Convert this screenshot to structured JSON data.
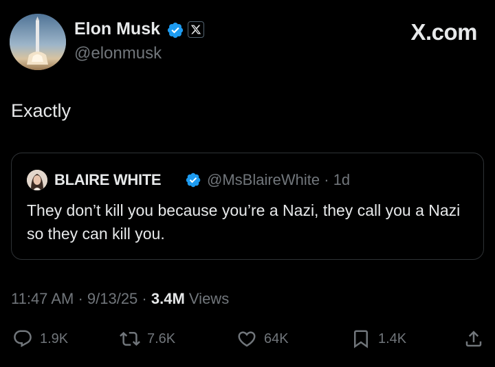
{
  "author": {
    "name": "Elon Musk",
    "handle": "@elonmusk",
    "verified": true,
    "affiliate_icon": "x-logo-icon"
  },
  "brand": "X.com",
  "tweet": {
    "text": "Exactly"
  },
  "quoted_tweet": {
    "author_name": "BLAIRE WHITE",
    "verified": true,
    "meta": "@MsBlaireWhite · 1d",
    "text": "They don’t kill you because you’re a Nazi, they call you a Nazi so they can kill you."
  },
  "timestamp": {
    "time": "11:47 AM",
    "date": "9/13/25",
    "views_count": "3.4M",
    "views_label": "Views"
  },
  "actions": {
    "reply": {
      "icon": "reply-icon",
      "count": "1.9K"
    },
    "repost": {
      "icon": "repost-icon",
      "count": "7.6K"
    },
    "like": {
      "icon": "heart-icon",
      "count": "64K"
    },
    "bookmark": {
      "icon": "bookmark-icon",
      "count": "1.4K"
    },
    "share": {
      "icon": "share-icon"
    }
  },
  "colors": {
    "background": "#000000",
    "text_primary": "#e7e9ea",
    "text_secondary": "#71767b",
    "verified_blue": "#1d9bf0",
    "border": "#2f3336"
  }
}
